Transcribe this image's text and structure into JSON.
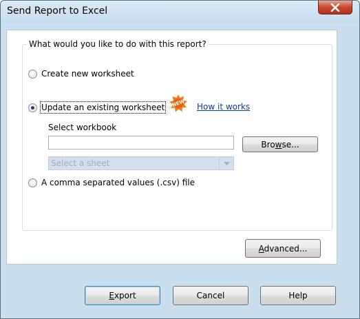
{
  "window": {
    "title": "Send Report to Excel",
    "close_icon": "close-icon"
  },
  "group": {
    "legend": "What would you like to do with this report?"
  },
  "options": {
    "create_new": {
      "label": "Create new worksheet",
      "selected": false
    },
    "update_existing": {
      "label": "Update an existing worksheet",
      "selected": true
    },
    "csv": {
      "label": "A comma separated values (.csv) file",
      "selected": false
    }
  },
  "new_badge": {
    "text": "NEW",
    "icon": "new-starburst-icon",
    "color": "#f47a20"
  },
  "how_it_works_link": "How it works",
  "select_workbook": {
    "label": "Select workbook",
    "value": ""
  },
  "browse_button": {
    "pre": "Bro",
    "accel": "w",
    "post": "se..."
  },
  "sheet_select": {
    "placeholder": "Select a sheet",
    "enabled": false
  },
  "advanced_button": {
    "pre": "",
    "accel": "A",
    "post": "dvanced..."
  },
  "footer": {
    "export": {
      "pre": "",
      "accel": "E",
      "post": "xport"
    },
    "cancel": "Cancel",
    "help": "Help"
  },
  "colors": {
    "window_frame": "#c9dfee",
    "link": "#0b3d9c",
    "close_button": "#c44a2e",
    "disabled_combo": "#d3dfed"
  }
}
